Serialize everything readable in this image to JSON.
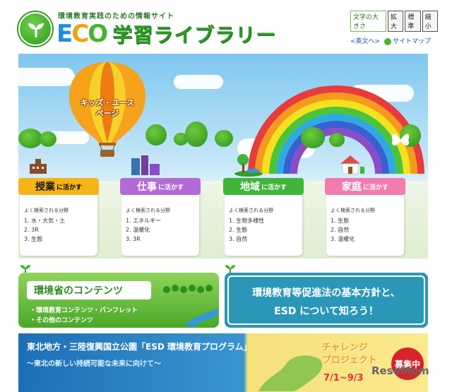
{
  "header": {
    "tagline": "環境教育実践のための情報サイト",
    "logo_eco_e": "E",
    "logo_eco_c": "C",
    "logo_eco_o": "O",
    "logo_title": "学習ライブラリー",
    "font_size_label": "文字の大きさ",
    "font_size_buttons": [
      "拡大",
      "標準",
      "縮小"
    ],
    "english_link": "<英文へ>",
    "sitemap_link": "サイトマップ"
  },
  "hero": {
    "balloon_label_line1": "キッズ・ユース",
    "balloon_label_line2": "ページ"
  },
  "categories": [
    {
      "main": "授業",
      "suffix": "に活かす",
      "head": "よく検索される分野",
      "items": [
        "1. 水・大気・土",
        "2. 3R",
        "3. 生態"
      ]
    },
    {
      "main": "仕事",
      "suffix": "に活かす",
      "head": "よく検索される分野",
      "items": [
        "1. エネルギー",
        "2. 温暖化",
        "3. 3R"
      ]
    },
    {
      "main": "地域",
      "suffix": "に活かす",
      "head": "よく検索される分野",
      "items": [
        "1. 生物多様性",
        "2. 生態",
        "3. 自然"
      ]
    },
    {
      "main": "家庭",
      "suffix": "に活かす",
      "head": "よく検索される分野",
      "items": [
        "1. 生態",
        "2. 自然",
        "3. 温暖化"
      ]
    }
  ],
  "banner_green": {
    "title": "環境省のコンテンツ",
    "items": [
      "・環境教育コンテンツ・パンフレット",
      "・その他のコンテンツ"
    ]
  },
  "banner_blue": {
    "line1": "環境教育等促進法の基本方針と、",
    "line2": "ESD について知ろう！"
  },
  "banner_bottom": {
    "title": "東北地方・三陸復興国立公園「ESD 環境教育プログラム」",
    "subtitle": "～東北の新しい持続可能な未来に向けて～",
    "challenge_line1": "チャレンジ",
    "challenge_line2": "プロジェクト",
    "recruit": "募集中",
    "date": "7/1~9/3"
  },
  "watermark": "ReseMom",
  "colors": {
    "brand_green": "#2e9b26",
    "tab_lesson": "#f6b31a",
    "tab_work": "#b46ad6",
    "tab_region": "#3fb53a",
    "tab_home": "#f27bb0"
  }
}
